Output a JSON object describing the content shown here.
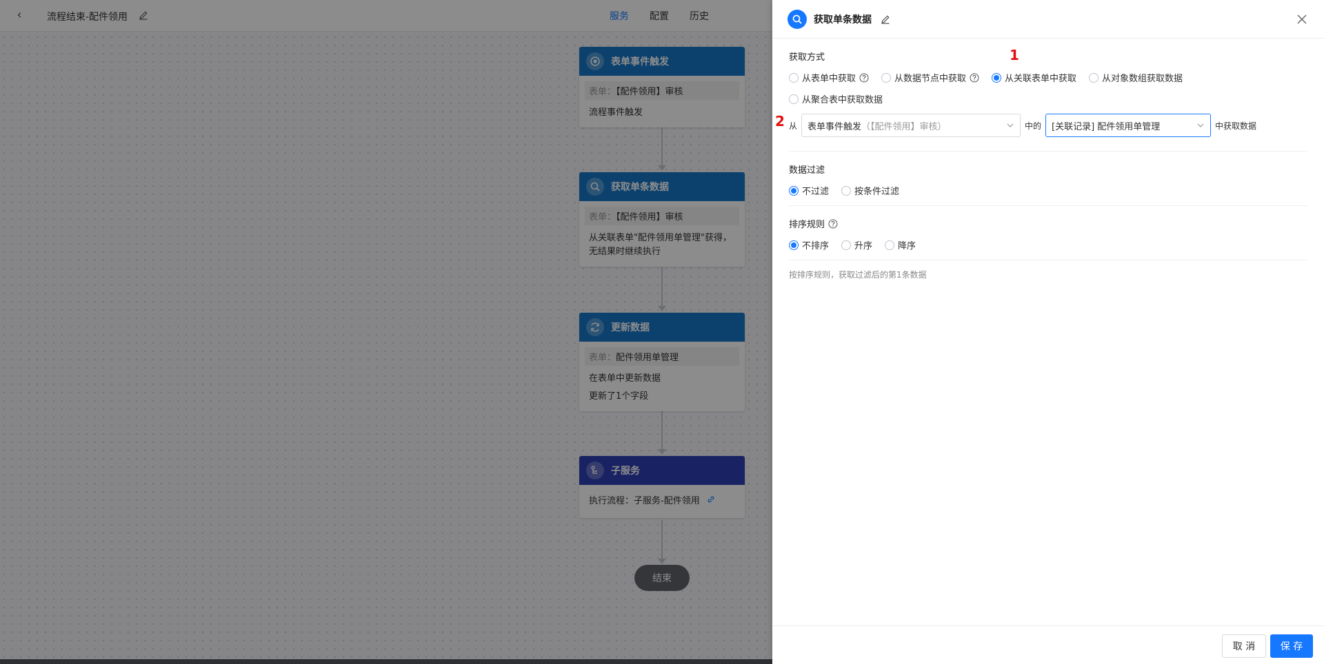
{
  "topbar": {
    "title": "流程结束-配件领用",
    "tabs": [
      {
        "label": "服务",
        "active": true
      },
      {
        "label": "配置",
        "active": false
      },
      {
        "label": "历史",
        "active": false
      }
    ]
  },
  "flow": {
    "nodes": [
      {
        "title": "表单事件触发",
        "tag_label": "表单：",
        "tag_value": "【配件领用】审核",
        "lines": [
          "流程事件触发"
        ],
        "icon": "target-icon"
      },
      {
        "title": "获取单条数据",
        "tag_label": "表单：",
        "tag_value": "【配件领用】审核",
        "lines": [
          "从关联表单\"配件领用单管理\"获得，",
          "无结果时继续执行"
        ],
        "icon": "search-icon"
      },
      {
        "title": "更新数据",
        "tag_label": "表单：",
        "tag_value": "配件领用单管理",
        "lines": [
          "在表单中更新数据",
          "更新了1个字段"
        ],
        "icon": "refresh-icon"
      },
      {
        "title": "子服务",
        "line": "执行流程：子服务-配件领用",
        "icon": "subservice-icon"
      }
    ],
    "end_label": "结束"
  },
  "panel": {
    "title": "获取单条数据",
    "fetch_method": {
      "label": "获取方式",
      "options": [
        "从表单中获取",
        "从数据节点中获取",
        "从关联表单中获取",
        "从对象数组获取数据",
        "从聚合表中获取数据"
      ],
      "selected": "从关联表单中获取"
    },
    "markers": [
      "1",
      "2"
    ],
    "from_row": {
      "prefix": "从",
      "source_main": "表单事件触发",
      "source_muted": "（【配件领用】审核）",
      "middle": "中的",
      "target": "[关联记录] 配件领用单管理",
      "suffix": "中获取数据"
    },
    "filter": {
      "label": "数据过滤",
      "options": [
        "不过滤",
        "按条件过滤"
      ],
      "selected": "不过滤"
    },
    "sort": {
      "label": "排序规则",
      "options": [
        "不排序",
        "升序",
        "降序"
      ],
      "selected": "不排序"
    },
    "hint": "按排序规则，获取过滤后的第1条数据",
    "footer": {
      "cancel": "取 消",
      "save": "保 存"
    }
  },
  "colors": {
    "primary": "#1677ff",
    "node_blue": "#1677c8",
    "node_indigo": "#2f3fb5",
    "marker_red": "#e01010"
  }
}
